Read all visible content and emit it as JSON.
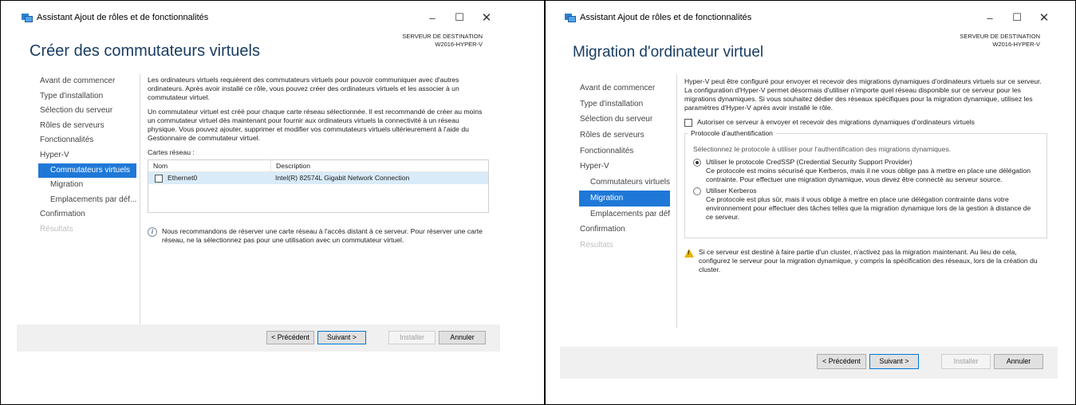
{
  "left": {
    "window_title": "Assistant Ajout de rôles et de fonctionnalités",
    "page_title": "Créer des commutateurs virtuels",
    "dest_label": "SERVEUR DE DESTINATION",
    "dest_server": "W2016-HYPER-V",
    "nav": [
      "Avant de commencer",
      "Type d'installation",
      "Sélection du serveur",
      "Rôles de serveurs",
      "Fonctionnalités",
      "Hyper-V",
      "Commutateurs virtuels",
      "Migration",
      "Emplacements par déf...",
      "Confirmation",
      "Résultats"
    ],
    "para1": "Les ordinateurs virtuels requièrent des commutateurs virtuels pour pouvoir communiquer avec d'autres ordinateurs. Après avoir installé ce rôle, vous pouvez créer des ordinateurs virtuels et les associer à un commutateur virtuel.",
    "para2": "Un commutateur virtuel est créé pour chaque carte réseau sélectionnée. Il est recommandé de créer au moins un commutateur virtuel dès maintenant pour fournir aux ordinateurs virtuels la connectivité à un réseau physique. Vous pouvez ajouter, supprimer et modifier vos commutateurs virtuels ultérieurement à l'aide du Gestionnaire de commutateur virtuel.",
    "cards_label": "Cartes réseau :",
    "col_name": "Nom",
    "col_desc": "Description",
    "row_name": "Ethernet0",
    "row_desc": "Intel(R) 82574L Gigabit Network Connection",
    "info": "Nous recommandons de réserver une carte réseau à l'accès distant à ce serveur. Pour réserver une carte réseau, ne la sélectionnez pas pour une utilisation avec un commutateur virtuel.",
    "buttons": {
      "prev": "< Précédent",
      "next": "Suivant >",
      "install": "Installer",
      "cancel": "Annuler"
    }
  },
  "right": {
    "window_title": "Assistant Ajout de rôles et de fonctionnalités",
    "page_title": "Migration d'ordinateur virtuel",
    "dest_label": "SERVEUR DE DESTINATION",
    "dest_server": "W2016-HYPER-V",
    "nav": [
      "Avant de commencer",
      "Type d'installation",
      "Sélection du serveur",
      "Rôles de serveurs",
      "Fonctionnalités",
      "Hyper-V",
      "Commutateurs virtuels",
      "Migration",
      "Emplacements par déf...",
      "Confirmation",
      "Résultats"
    ],
    "para1": "Hyper-V peut être configuré pour envoyer et recevoir des migrations dynamiques d'ordinateurs virtuels sur ce serveur. La configuration d'Hyper-V permet désormais d'utiliser n'importe quel réseau disponible sur ce serveur pour les migrations dynamiques. Si vous souhaitez dédier des réseaux spécifiques pour la migration dynamique, utilisez les paramètres d'Hyper-V après avoir installé le rôle.",
    "allow_checkbox": "Autoriser ce serveur à envoyer et recevoir des migrations dynamiques d'ordinateurs virtuels",
    "group_title": "Protocole d'authentification",
    "group_hint": "Sélectionnez le protocole à utiliser pour l'authentification des migrations dynamiques.",
    "opt1_label": "Utiliser le protocole CredSSP (Credential Security Support Provider)",
    "opt1_desc": "Ce protocole est moins sécurisé que Kerberos, mais il ne vous oblige pas à mettre en place une délégation contrainte. Pour effectuer une migration dynamique, vous devez être connecté au serveur source.",
    "opt2_label": "Utiliser Kerberos",
    "opt2_desc": "Ce protocole est plus sûr, mais il vous oblige à mettre en place une délégation contrainte dans votre environnement pour effectuer des tâches telles que la migration dynamique lors de la gestion à distance de ce serveur.",
    "warning": "Si ce serveur est destiné à faire partie d'un cluster, n'activez pas la migration maintenant. Au lieu de cela, configurez le serveur pour la migration dynamique, y compris la spécification des réseaux, lors de la création du cluster.",
    "buttons": {
      "prev": "< Précédent",
      "next": "Suivant >",
      "install": "Installer",
      "cancel": "Annuler"
    }
  },
  "colors": {
    "accent": "#1f78d7",
    "title": "#1a3d63",
    "footer": "#f0f0f0",
    "warning": "#e6b400"
  }
}
